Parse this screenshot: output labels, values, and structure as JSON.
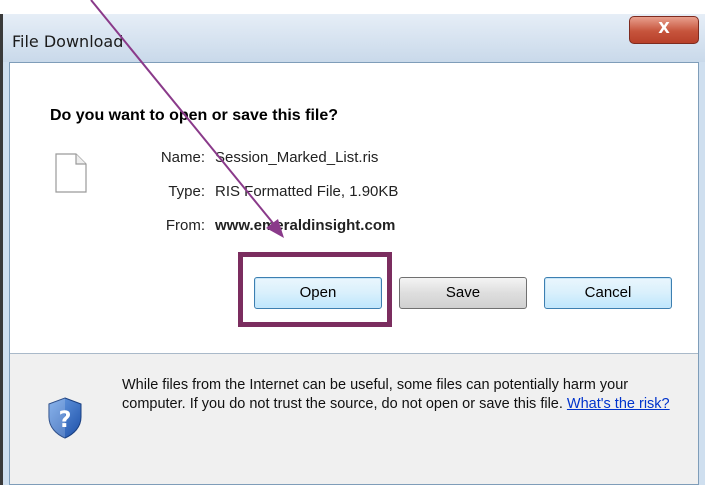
{
  "dialog": {
    "title": "File Download",
    "close_label": "X",
    "question": "Do you want to open or save this file?"
  },
  "file": {
    "name_label": "Name:",
    "name": "Session_Marked_List.ris",
    "type_label": "Type:",
    "type": "RIS Formatted File, 1.90KB",
    "from_label": "From:",
    "from": "www.emeraldinsight.com"
  },
  "buttons": {
    "open": "Open",
    "save": "Save",
    "cancel": "Cancel"
  },
  "warning": {
    "text": "While files from the Internet can be useful, some files can potentially harm your computer. If you do not trust the source, do not open or save this file.",
    "link": "What's the risk?"
  },
  "icons": {
    "file": "file-icon",
    "shield": "shield-question-icon",
    "close": "close-icon"
  },
  "colors": {
    "annotation": "#7b2d5f",
    "link": "#0033cc",
    "close_button": "#c6543c"
  }
}
